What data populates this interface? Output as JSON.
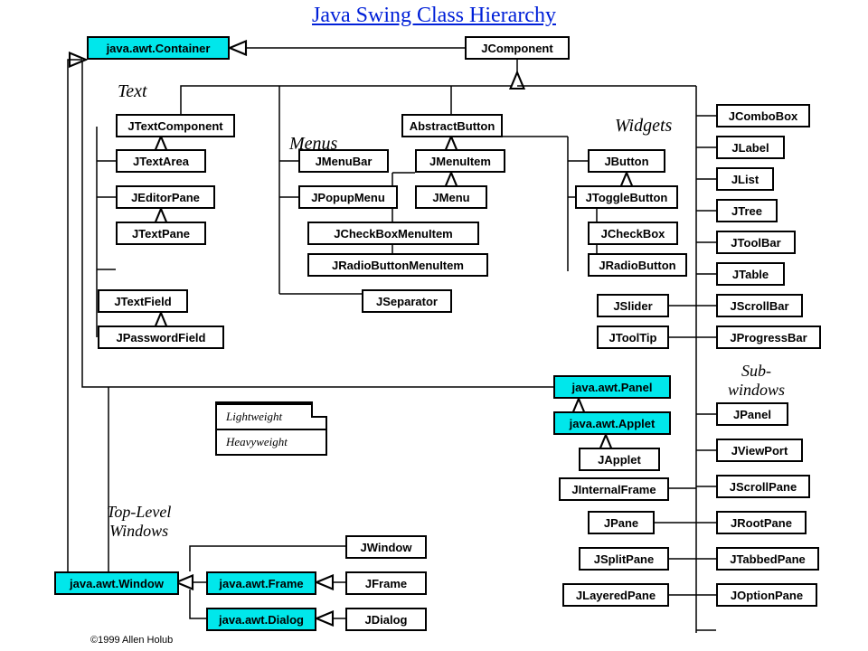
{
  "title": "Java Swing Class Hierarchy",
  "copyright": "©1999 Allen Holub",
  "groups": {
    "text": "Text",
    "menus": "Menus",
    "widgets": "Widgets",
    "subwindows": "Sub-\nwindows",
    "toplevel": "Top-Level\nWindows"
  },
  "legend": {
    "light": "Lightweight",
    "heavy": "Heavyweight"
  },
  "boxes": {
    "container": "java.awt.Container",
    "jcomponent": "JComponent",
    "jtextcomp": "JTextComponent",
    "jtextarea": "JTextArea",
    "jeditorpane": "JEditorPane",
    "jtextpane": "JTextPane",
    "jtextfield": "JTextField",
    "jpassword": "JPasswordField",
    "absbutton": "AbstractButton",
    "jmenubar": "JMenuBar",
    "jpopupmenu": "JPopupMenu",
    "jmenuitem": "JMenuItem",
    "jmenu": "JMenu",
    "jcheckmenu": "JCheckBoxMenuItem",
    "jradiomenu": "JRadioButtonMenuItem",
    "jseparator": "JSeparator",
    "jbutton": "JButton",
    "jtoggle": "JToggleButton",
    "jcheckbox": "JCheckBox",
    "jradio": "JRadioButton",
    "jslider": "JSlider",
    "jtooltip": "JToolTip",
    "jcombobox": "JComboBox",
    "jlabel": "JLabel",
    "jlist": "JList",
    "jtree": "JTree",
    "jtoolbar": "JToolBar",
    "jtable": "JTable",
    "jscrollbar": "JScrollBar",
    "jprogress": "JProgressBar",
    "awtpanel": "java.awt.Panel",
    "awtapplet": "java.awt.Applet",
    "japplet": "JApplet",
    "jinternal": "JInternalFrame",
    "jpanel": "JPanel",
    "jviewport": "JViewPort",
    "jscrollpane": "JScrollPane",
    "jpane": "JPane",
    "jsplitpane": "JSplitPane",
    "jlayered": "JLayeredPane",
    "jrootpane": "JRootPane",
    "jtabbed": "JTabbedPane",
    "joption": "JOptionPane",
    "awtwindow": "java.awt.Window",
    "awtframe": "java.awt.Frame",
    "awtdialog": "java.awt.Dialog",
    "jwindow": "JWindow",
    "jframe": "JFrame",
    "jdialog": "JDialog"
  }
}
